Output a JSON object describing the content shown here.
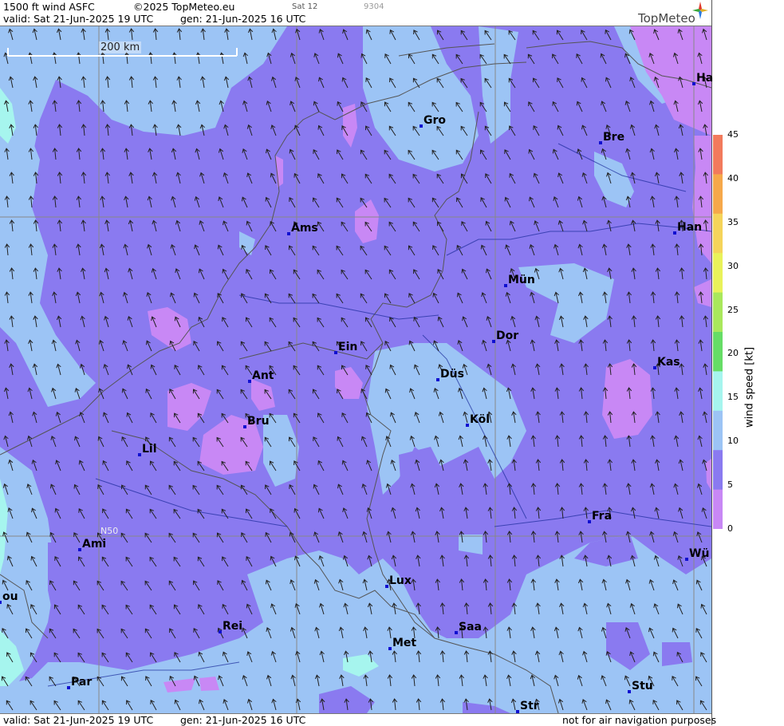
{
  "header": {
    "product": "1500 ft wind ASFC",
    "copyright": "©2025 TopMeteo.eu",
    "run_tag": "Sat 12",
    "code": "9304",
    "valid": "valid:  Sat  21-Jun-2025  19 UTC",
    "generated": "gen: 21-Jun-2025 16 UTC",
    "logo_text": "TopMeteo"
  },
  "footer": {
    "valid": "valid:  Sat  21-Jun-2025  19 UTC",
    "generated": "gen: 21-Jun-2025 16 UTC",
    "disclaimer": "not for air navigation purposes"
  },
  "scale_bar": {
    "label": "200 km"
  },
  "latitude_label": "N50",
  "colorbar": {
    "unit_label": "wind  speed  [kt]",
    "ticks": [
      "45",
      "40",
      "35",
      "30",
      "25",
      "20",
      "15",
      "10",
      "5",
      "0"
    ],
    "colors": [
      "#f27a5c",
      "#f6a84a",
      "#f5d45a",
      "#e9f25a",
      "#a9e85c",
      "#66dd66",
      "#a6f5ee",
      "#9cc4f5",
      "#8a7af0",
      "#c888f5"
    ]
  },
  "cities": [
    {
      "name": "Ha"
    },
    {
      "name": "Gro"
    },
    {
      "name": "Bre"
    },
    {
      "name": "Ams"
    },
    {
      "name": "Han"
    },
    {
      "name": "Mün"
    },
    {
      "name": "Ein"
    },
    {
      "name": "Dor"
    },
    {
      "name": "Ant"
    },
    {
      "name": "Düs"
    },
    {
      "name": "Kas"
    },
    {
      "name": "Bru"
    },
    {
      "name": "Köl"
    },
    {
      "name": "Lil"
    },
    {
      "name": "Fra"
    },
    {
      "name": "Ami"
    },
    {
      "name": "Wü"
    },
    {
      "name": "ou"
    },
    {
      "name": "Lux"
    },
    {
      "name": "Rei"
    },
    {
      "name": "Saa"
    },
    {
      "name": "Met"
    },
    {
      "name": "Par"
    },
    {
      "name": "Stu"
    },
    {
      "name": "Str"
    }
  ],
  "wind_colors": {
    "calm": "#c888f5",
    "light": "#8a7af0",
    "moderate": "#9cc4f5",
    "fresh": "#a6f5ee"
  }
}
